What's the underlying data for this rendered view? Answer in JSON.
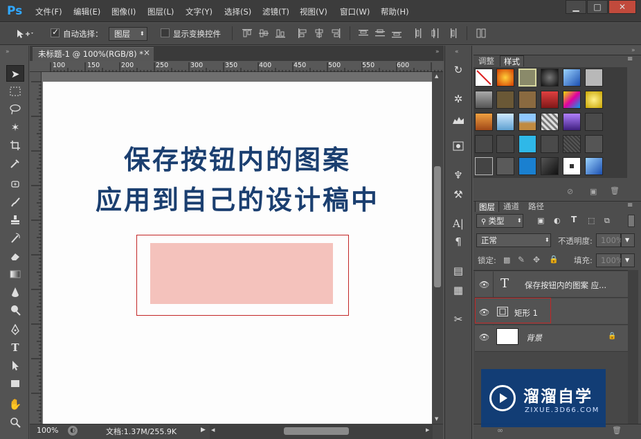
{
  "app": {
    "logo": "Ps"
  },
  "menu": [
    "文件(F)",
    "编辑(E)",
    "图像(I)",
    "图层(L)",
    "文字(Y)",
    "选择(S)",
    "滤镜(T)",
    "视图(V)",
    "窗口(W)",
    "帮助(H)"
  ],
  "window_controls": {
    "minimize": "▁",
    "restore": "□",
    "close": "✕"
  },
  "options": {
    "auto_select_label": "自动选择：",
    "auto_select_checked": true,
    "target_value": "图层",
    "show_transform_label": "显示变换控件",
    "show_transform_checked": false
  },
  "document": {
    "tab_title": "未标题-1 @ 100%(RGB/8) *",
    "tab_close": "×",
    "zoom": "100%",
    "doc_info": "文档:1.37M/255.9K",
    "ruler_ticks": [
      "100",
      "150",
      "200",
      "250",
      "300",
      "350",
      "400",
      "450",
      "500",
      "550",
      "600"
    ]
  },
  "canvas": {
    "line1": "保存按钮内的图案",
    "line2": "应用到自己的设计稿中",
    "text_color": "#1b3f70",
    "rect_color": "#f4c2bc",
    "frame_color": "#c22626"
  },
  "styles_panel": {
    "tabs": [
      "调整",
      "样式"
    ],
    "active_tab": "样式"
  },
  "layers_panel": {
    "tabs": [
      "图层",
      "通道",
      "路径"
    ],
    "active_tab": "图层",
    "filter_label": "类型",
    "blend_mode": "正常",
    "opacity_label": "不透明度:",
    "opacity_value": "100%",
    "lock_label": "锁定:",
    "fill_label": "填充:",
    "fill_value": "100%",
    "layers": [
      {
        "name": "保存按钮内的图案 应...",
        "kind": "text",
        "visible": true
      },
      {
        "name": "矩形 1",
        "kind": "shape",
        "visible": true,
        "selected": true
      },
      {
        "name": "背景",
        "kind": "background",
        "visible": true,
        "locked": true
      }
    ]
  },
  "watermark": {
    "title": "溜溜自学",
    "url": "ZIXUE.3D66.COM"
  }
}
